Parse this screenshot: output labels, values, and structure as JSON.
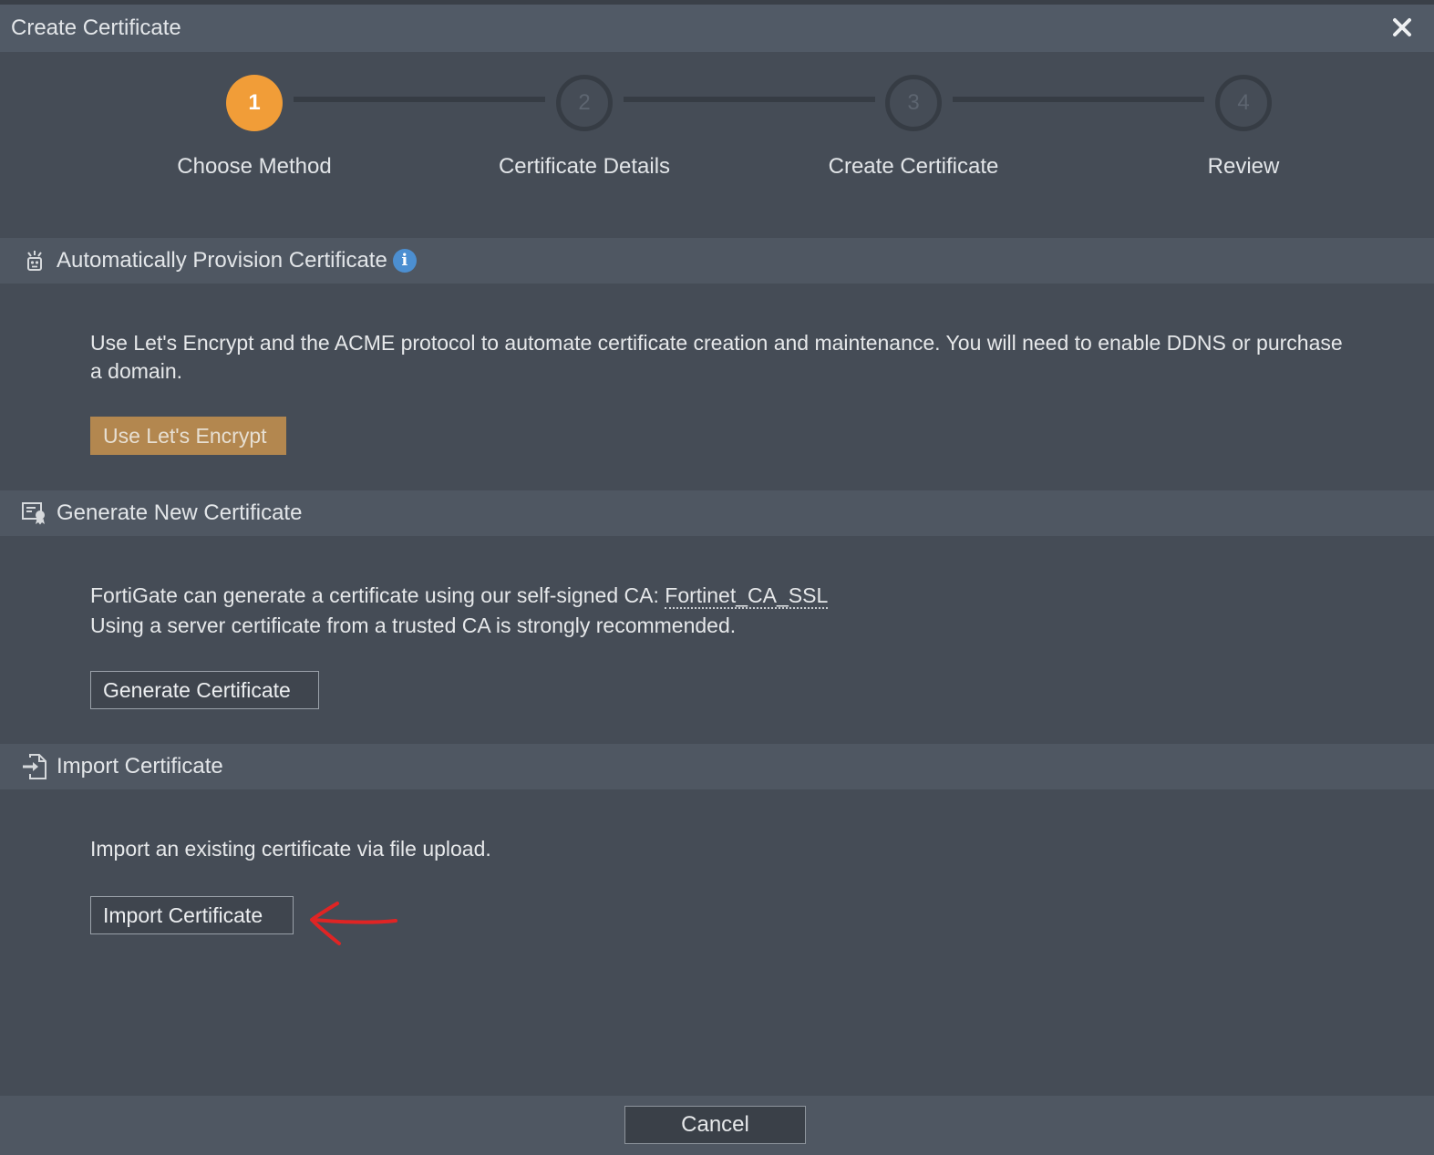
{
  "dialog": {
    "title": "Create Certificate",
    "close_icon": "close-icon"
  },
  "wizard": {
    "steps": [
      {
        "number": "1",
        "label": "Choose Method",
        "state": "active"
      },
      {
        "number": "2",
        "label": "Certificate Details",
        "state": "inactive"
      },
      {
        "number": "3",
        "label": "Create Certificate",
        "state": "inactive"
      },
      {
        "number": "4",
        "label": "Review",
        "state": "inactive"
      }
    ],
    "active_color": "#f19d38"
  },
  "sections": {
    "auto": {
      "icon": "robot-icon",
      "title": "Automatically Provision Certificate",
      "info_icon": "info-icon",
      "description": "Use Let's Encrypt and the ACME protocol to automate certificate creation and maintenance. You will need to enable DDNS or purchase a domain.",
      "button_label": "Use Let's Encrypt"
    },
    "generate": {
      "icon": "certificate-icon",
      "title": "Generate New Certificate",
      "description_prefix": "FortiGate can generate a certificate using our self-signed CA: ",
      "ca_name": "Fortinet_CA_SSL",
      "description_line2": "Using a server certificate from a trusted CA is strongly recommended.",
      "button_label": "Generate Certificate"
    },
    "import": {
      "icon": "file-import-icon",
      "title": "Import Certificate",
      "description": "Import an existing certificate via file upload.",
      "button_label": "Import Certificate"
    }
  },
  "footer": {
    "cancel_label": "Cancel"
  },
  "annotation": {
    "icon": "red-arrow-annotation",
    "color": "#e02424"
  }
}
